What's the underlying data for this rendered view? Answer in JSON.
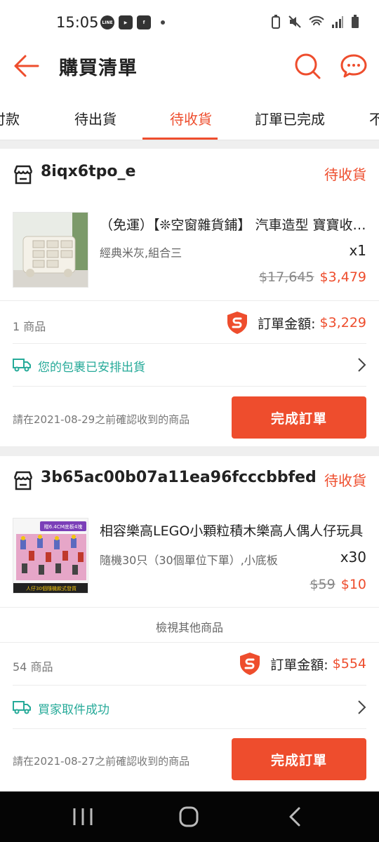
{
  "status_bar": {
    "time": "15:05",
    "app_icons": [
      "line-icon",
      "youtube-icon",
      "facebook-icon"
    ],
    "app_labels": [
      "LINE",
      "▶",
      "f"
    ]
  },
  "header": {
    "title": "購買清單",
    "accent": "#ee4d2d"
  },
  "tabs": [
    {
      "label": "付款",
      "active": false
    },
    {
      "label": "待出貨",
      "active": false
    },
    {
      "label": "待收貨",
      "active": true
    },
    {
      "label": "訂單已完成",
      "active": false
    },
    {
      "label": "不",
      "active": false
    }
  ],
  "orders": [
    {
      "shop": "8iqx6tpo_e",
      "status": "待收貨",
      "product": {
        "title": "（免運）【❊空窗雜貨鋪】 汽車造型 寶寶收納櫃",
        "variant": "經典米灰,組合三",
        "qty": "x1",
        "price_old": "$17,645",
        "price_new": "$3,479"
      },
      "count": "1 商品",
      "total_label": "訂單金額:",
      "total": "$3,229",
      "shipping": "您的包裹已安排出貨",
      "note": "請在2021-08-29之前確認收到的商品",
      "button": "完成訂單"
    },
    {
      "shop": "3b65ac00b07a11ea96fcccbbfed",
      "status": "待收貨",
      "product": {
        "title": "相容樂高LEGO小顆粒積木樂高人偶人仔玩具",
        "variant": "隨機30只（30個單位下單）,小底板",
        "qty": "x30",
        "price_old": "$59",
        "price_new": "$10",
        "img_top_label": "贈6.4CM底板4塊",
        "img_bottom_label": "人仔30個隨機款式發貨"
      },
      "more": "檢視其他商品",
      "count": "54 商品",
      "total_label": "訂單金額:",
      "total": "$554",
      "shipping": "買家取件成功",
      "note": "請在2021-08-27之前確認收到的商品",
      "button": "完成訂單"
    }
  ],
  "nav": [
    "recent-apps-icon",
    "home-icon",
    "back-nav-icon"
  ]
}
